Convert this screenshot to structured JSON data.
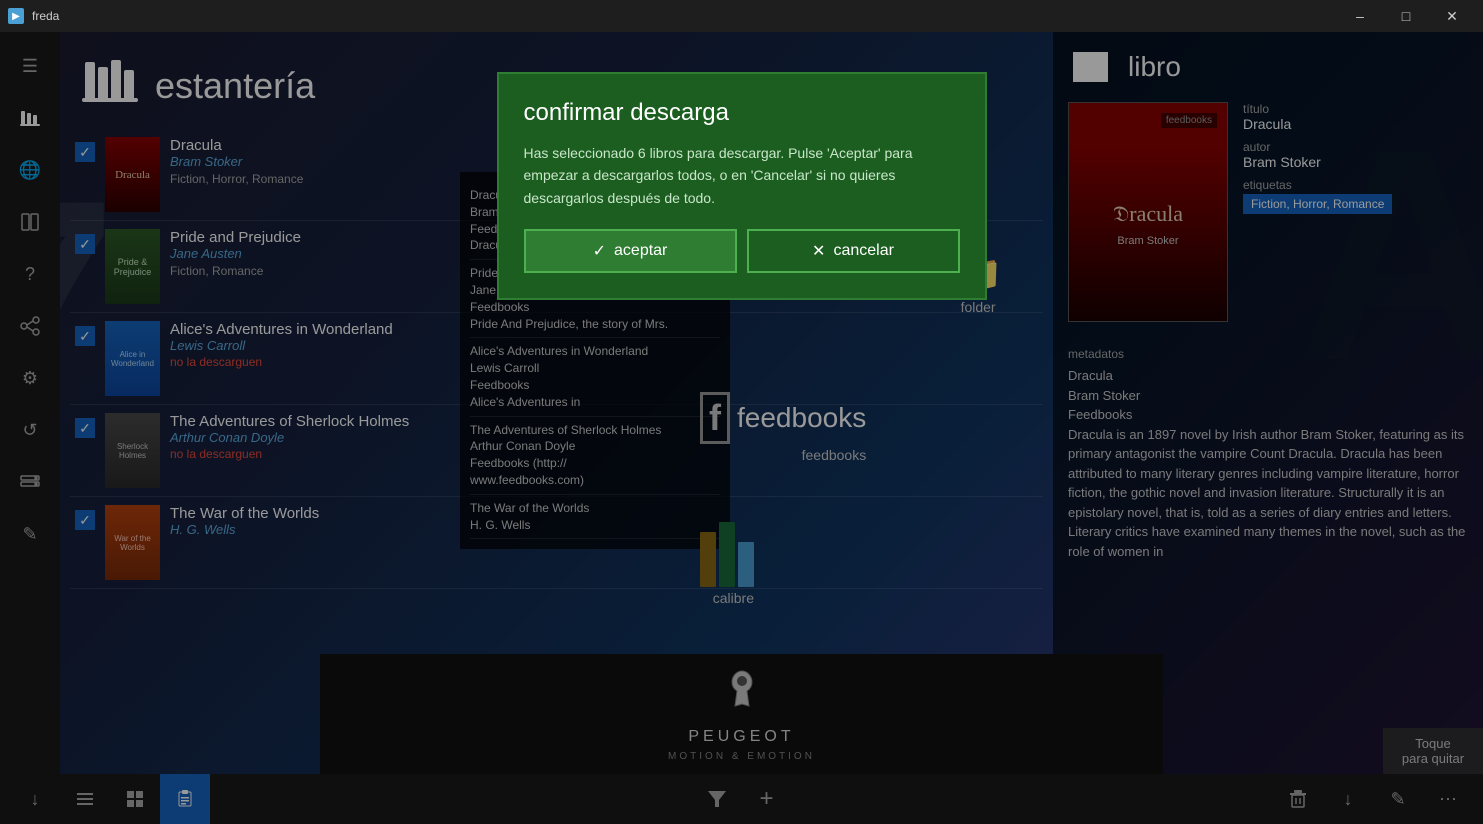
{
  "titleBar": {
    "title": "freda",
    "minimize": "–",
    "maximize": "□",
    "close": "✕"
  },
  "sidebar": {
    "items": [
      {
        "icon": "☰",
        "name": "menu"
      },
      {
        "icon": "📚",
        "name": "bookshelf"
      },
      {
        "icon": "🌐",
        "name": "catalog"
      },
      {
        "icon": "📋",
        "name": "reading"
      },
      {
        "icon": "❓",
        "name": "help"
      },
      {
        "icon": "🔗",
        "name": "connect"
      },
      {
        "icon": "⚙",
        "name": "settings"
      },
      {
        "icon": "↺",
        "name": "sync"
      },
      {
        "icon": "💾",
        "name": "storage"
      },
      {
        "icon": "✎",
        "name": "edit"
      }
    ]
  },
  "bookshelf": {
    "heading": "estantería",
    "books": [
      {
        "id": "dracula",
        "title": "Dracula",
        "author": "Bram Stoker",
        "tags": "Fiction, Horror, Romance",
        "checked": true,
        "status": ""
      },
      {
        "id": "pride",
        "title": "Pride and Prejudice",
        "author": "Jane Austen",
        "tags": "Fiction, Romance",
        "checked": true,
        "status": ""
      },
      {
        "id": "alice",
        "title": "Alice's Adventures in Wonderland",
        "author": "Lewis Carroll",
        "tags": "",
        "checked": true,
        "status": "no la descarguen"
      },
      {
        "id": "sherlock",
        "title": "The Adventures of Sherlock Holmes",
        "author": "Arthur Conan Doyle",
        "tags": "",
        "checked": true,
        "status": "no la descarguen"
      },
      {
        "id": "war",
        "title": "The War of the Worlds",
        "author": "H. G. Wells",
        "tags": "",
        "checked": true,
        "status": ""
      }
    ]
  },
  "sourcePanel": {
    "items": [
      {
        "text": "Dracula\nBram Stoker\nFeedbooks\nDracula is an 1897 novel by Irish author"
      },
      {
        "text": "Pride and Prejudice\nJane Austen\nFeedbooks\nPride And Prejudice, the story of Mrs."
      },
      {
        "text": "Alice's Adventures in\nWonderland\nLewis Carroll\nFeedbooks\nAlice's Adventures in"
      },
      {
        "text": "The Adventures of\nSherlock Holmes\nArthur Conan Doyle\nFeedbooks (http://\nwww.feedbooks.com)"
      },
      {
        "text": "The War of the\nWorlds\nH. G. Wells"
      }
    ]
  },
  "folderBadge": {
    "label": "folder"
  },
  "feedbooksBadge": {
    "text": "feedbooks",
    "label": "feedbooks"
  },
  "calibreBadge": {
    "label": "calibre"
  },
  "modal": {
    "title": "confirmar descarga",
    "body": "Has seleccionado 6 libros para descargar.  Pulse 'Aceptar' para empezar a descargarlos todos, o en 'Cancelar' si no quieres descargarlos después de todo.",
    "acceptLabel": "aceptar",
    "cancelLabel": "cancelar"
  },
  "rightPanel": {
    "headerLabel": "libro",
    "titleLabel": "título",
    "titleValue": "Dracula",
    "authorLabel": "autor",
    "authorValue": "Bram Stoker",
    "tagsLabel": "etiquetas",
    "tagsValue": "Fiction, Horror, Romance",
    "metadataLabel": "metadatos",
    "metadataLines": [
      "Dracula",
      "Bram Stoker",
      "Feedbooks"
    ],
    "metadataBody": "Dracula is an 1897 novel by Irish author Bram Stoker, featuring as its primary antagonist the vampire Count Dracula. Dracula has been attributed to many literary genres including vampire literature, horror fiction, the gothic novel and invasion literature. Structurally it is an epistolary novel, that is, told as a series of diary entries and letters. Literary critics have examined many themes in the novel, such as the role of women in"
  },
  "adBanner": {
    "brand": "PEUGEOT",
    "tagline": "MOTION & EMOTION"
  },
  "touchToRemove": "Toque\npara quitar",
  "bottomToolbar": {
    "buttons": [
      {
        "icon": "↓",
        "name": "download",
        "active": false
      },
      {
        "icon": "≡",
        "name": "list-view",
        "active": false
      },
      {
        "icon": "⊞",
        "name": "grid-view",
        "active": false
      },
      {
        "icon": "📋",
        "name": "clipboard",
        "active": true
      },
      {
        "icon": "▽",
        "name": "filter",
        "active": false
      },
      {
        "icon": "+",
        "name": "add",
        "active": false
      },
      {
        "icon": "🗑",
        "name": "delete",
        "active": false
      },
      {
        "icon": "↓",
        "name": "download2",
        "active": false
      },
      {
        "icon": "✎",
        "name": "edit",
        "active": false
      },
      {
        "icon": "⋯",
        "name": "more",
        "active": false
      }
    ]
  }
}
